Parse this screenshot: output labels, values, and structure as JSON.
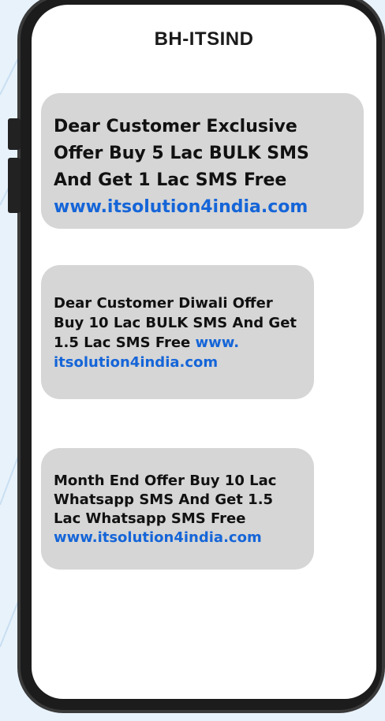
{
  "header": {
    "sender": "BH-ITSIND"
  },
  "messages": [
    {
      "text": "Dear Customer Exclusive Offer Buy 5 Lac BULK SMS And Get 1 Lac SMS Free",
      "link": "www.itsolution4india.com"
    },
    {
      "text": "Dear Customer Diwali Offer Buy 10 Lac BULK SMS And Get 1.5 Lac SMS Free",
      "link": "www. itsolution4india.com"
    },
    {
      "text": "Month End Offer Buy 10 Lac Whatsapp SMS And Get 1.5 Lac Whatsapp SMS Free",
      "link": "www.itsolution4india.com"
    }
  ],
  "colors": {
    "bubble": "#d6d6d6",
    "link": "#1565d8",
    "phone_frame": "#1c1c1c",
    "background": "#e8f2fb"
  }
}
